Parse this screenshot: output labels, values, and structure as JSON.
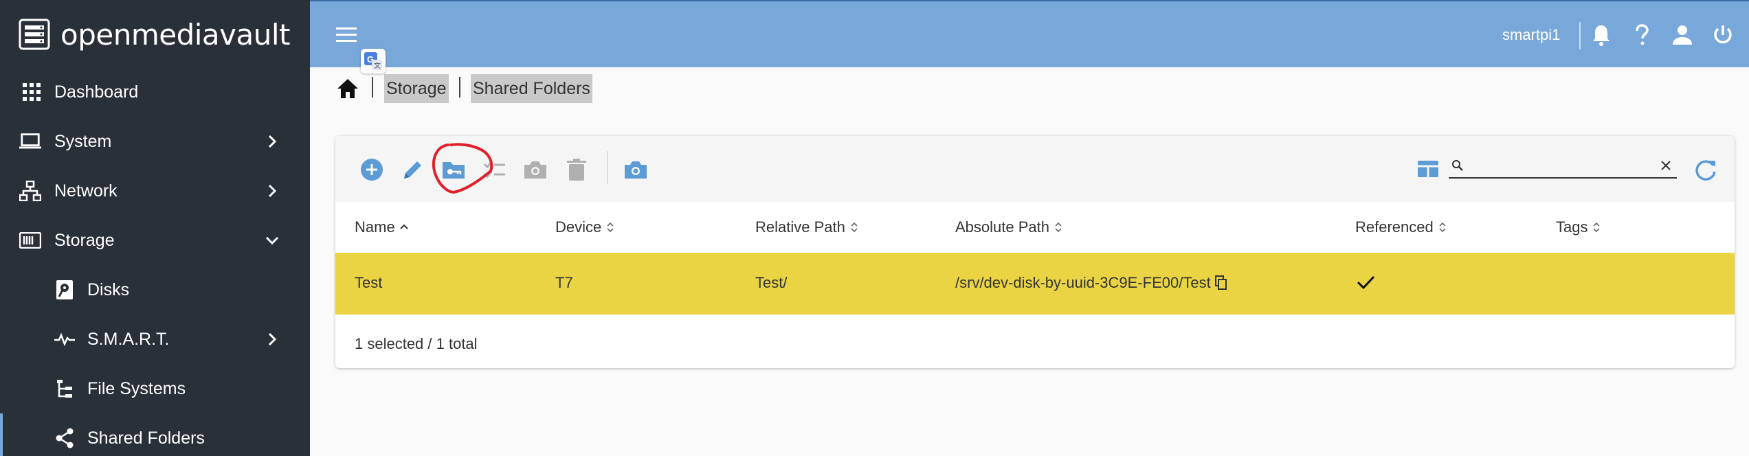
{
  "app": {
    "brand": "openmediavault",
    "username": "smartpi1"
  },
  "sidebar": {
    "items": [
      {
        "label": "Dashboard",
        "icon": "grid-icon"
      },
      {
        "label": "System",
        "icon": "laptop-icon"
      },
      {
        "label": "Network",
        "icon": "network-icon"
      },
      {
        "label": "Storage",
        "icon": "storage-icon"
      },
      {
        "label": "Disks",
        "icon": "disk-icon"
      },
      {
        "label": "S.M.A.R.T.",
        "icon": "pulse-icon"
      },
      {
        "label": "File Systems",
        "icon": "tree-icon"
      },
      {
        "label": "Shared Folders",
        "icon": "share-icon"
      }
    ]
  },
  "breadcrumb": {
    "items": [
      "Storage",
      "Shared Folders"
    ]
  },
  "table": {
    "columns": [
      "Name",
      "Device",
      "Relative Path",
      "Absolute Path",
      "Referenced",
      "Tags"
    ],
    "rows": [
      {
        "name": "Test",
        "device": "T7",
        "relative_path": "Test/",
        "absolute_path": "/srv/dev-disk-by-uuid-3C9E-FE00/Test",
        "referenced": true,
        "tags": ""
      }
    ],
    "footer": "1 selected / 1 total"
  },
  "search": {
    "value": "",
    "placeholder": ""
  },
  "colors": {
    "topbar": "#78a8d9",
    "sidebar": "#293038",
    "selected_row": "#ebd444",
    "accent": "#5c9bd6",
    "annotation": "#e0202a"
  }
}
